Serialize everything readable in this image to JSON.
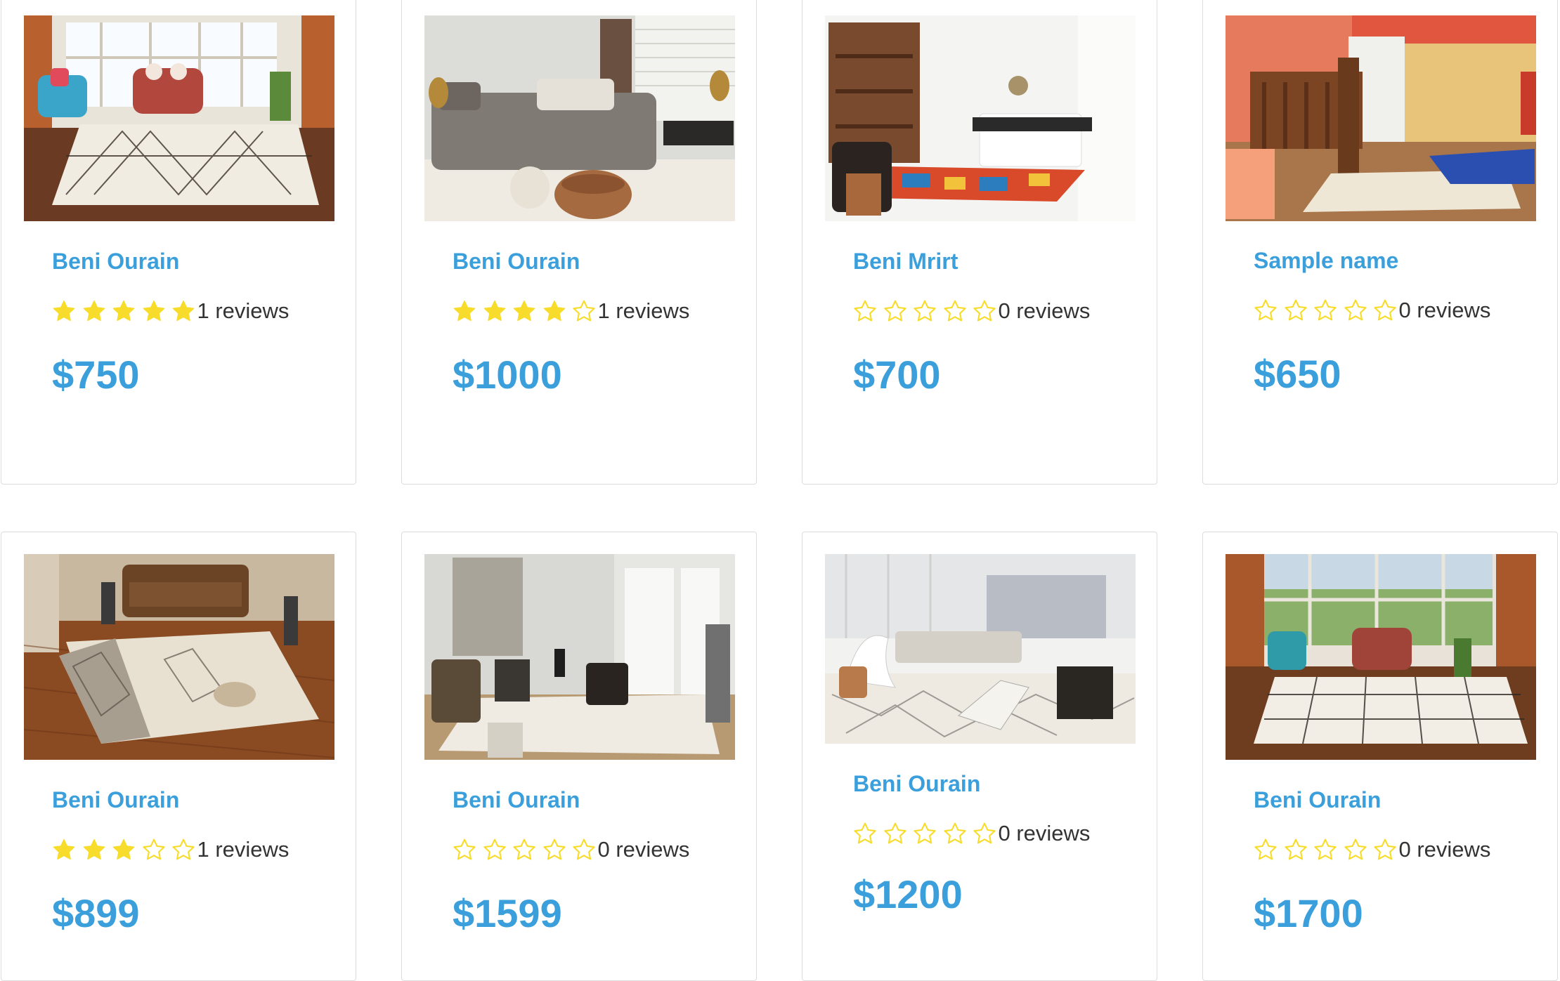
{
  "colors": {
    "accent": "#3b9fdc",
    "star": "#f7dc2b",
    "text": "#333333",
    "border": "#dcdcdc"
  },
  "products": [
    {
      "name": "Beni Ourain",
      "rating": 5,
      "reviews": "1 reviews",
      "price": "$750",
      "image": "photo-living-room-beni-ourain-rug-blue-armchair"
    },
    {
      "name": "Beni Ourain",
      "rating": 4,
      "reviews": "1 reviews",
      "price": "$1000",
      "image": "photo-lounge-grey-sofa-leather-pouf"
    },
    {
      "name": "Beni Mrirt",
      "rating": 0,
      "reviews": "0 reviews",
      "price": "$700",
      "image": "photo-white-bedroom-colorful-rug"
    },
    {
      "name": "Sample name",
      "rating": 0,
      "reviews": "0 reviews",
      "price": "$650",
      "image": "photo-coral-wall-room-wooden-staircase"
    },
    {
      "name": "Beni Ourain",
      "rating": 3,
      "reviews": "1 reviews",
      "price": "$899",
      "image": "photo-brown-leather-sofa-wood-floor-rug"
    },
    {
      "name": "Beni Ourain",
      "rating": 0,
      "reviews": "0 reviews",
      "price": "$1599",
      "image": "photo-grey-living-room-fireplace-rug"
    },
    {
      "name": "Beni Ourain",
      "rating": 0,
      "reviews": "0 reviews",
      "price": "$1200",
      "image": "photo-bright-loft-white-chairs-rug"
    },
    {
      "name": "Beni Ourain",
      "rating": 0,
      "reviews": "0 reviews",
      "price": "$1700",
      "image": "photo-living-room-windows-grid-rug"
    }
  ]
}
